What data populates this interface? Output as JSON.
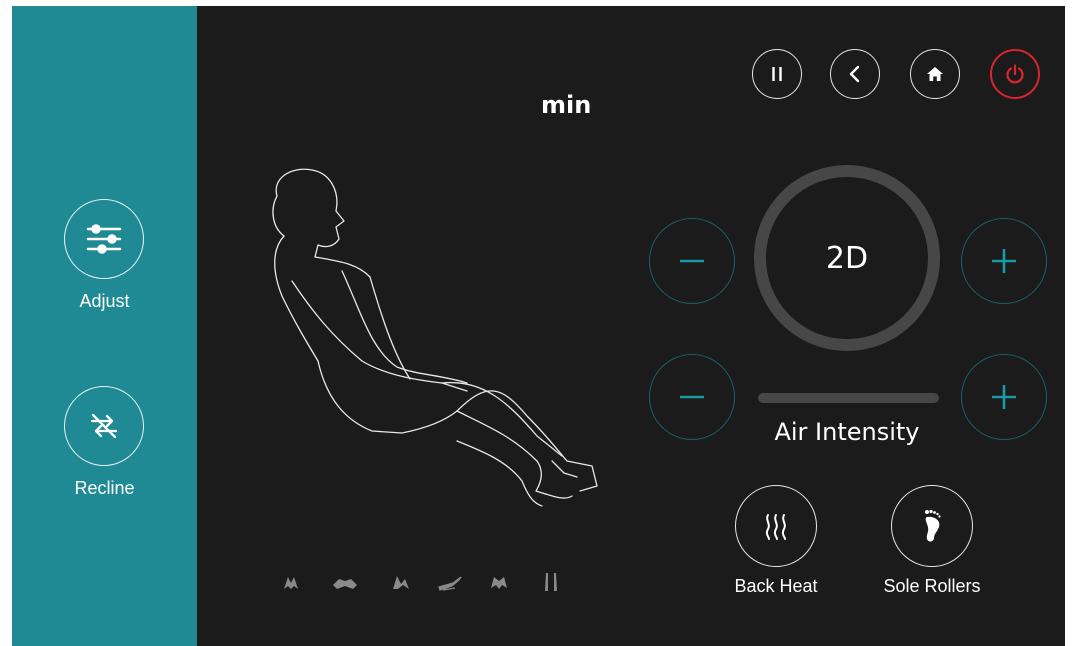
{
  "sidebar": {
    "items": [
      {
        "label": "Adjust",
        "icon": "sliders-icon"
      },
      {
        "label": "Recline",
        "icon": "recline-icon"
      }
    ]
  },
  "header": {
    "time_unit": "min",
    "buttons": [
      {
        "name": "pause-button",
        "icon": "pause-icon"
      },
      {
        "name": "back-button",
        "icon": "chevron-left-icon"
      },
      {
        "name": "home-button",
        "icon": "home-icon"
      },
      {
        "name": "power-button",
        "icon": "power-icon",
        "color": "#d9262c"
      }
    ]
  },
  "mode": {
    "label": "2D"
  },
  "air": {
    "label": "Air Intensity"
  },
  "features": [
    {
      "label": "Back Heat",
      "icon": "heat-icon"
    },
    {
      "label": "Sole Rollers",
      "icon": "foot-icon"
    }
  ],
  "presets": [
    "hands-preset-icon",
    "shoulder-preset-icon",
    "hands2-preset-icon",
    "recline-preset-icon",
    "stretch-preset-icon",
    "legs-preset-icon"
  ],
  "colors": {
    "accent": "#1f8a94",
    "control_plus": "#1c9aa6",
    "power": "#d9262c",
    "background": "#1b1b1b"
  }
}
